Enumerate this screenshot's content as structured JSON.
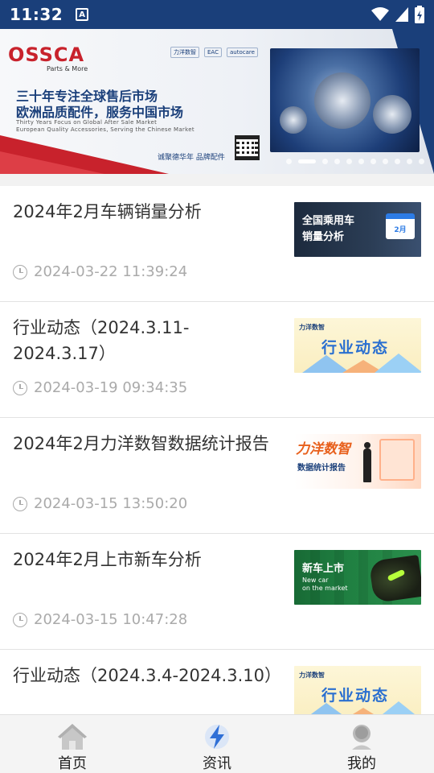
{
  "status_bar": {
    "time": "11:32",
    "a_badge": "A",
    "icons": [
      "wifi-icon",
      "signal-icon",
      "battery-icon"
    ]
  },
  "banner": {
    "brand": "OSSCA",
    "brand_sub": "Parts & More",
    "partner_logos": [
      "力洋数智",
      "EAC",
      "autocare"
    ],
    "headline1": "三十年专注全球售后市场",
    "headline2": "欧洲品质配件，服务中国市场",
    "tagline1": "Thirty Years Focus on Global After Sale Market",
    "tagline2": "European Quality Accessories, Serving the Chinese Market",
    "bottom_tag": "诚聚德华年  品牌配件",
    "carousel": {
      "count": 11,
      "active_index": 1
    }
  },
  "news": [
    {
      "title": "2024年2月车辆销量分析",
      "time": "2024-03-22 11:39:24",
      "thumb": {
        "type": "sales",
        "line1": "全国乘用车",
        "line2": "销量分析",
        "badge": "2月"
      }
    },
    {
      "title": "行业动态（2024.3.11-2024.3.17）",
      "time": "2024-03-19 09:34:35",
      "thumb": {
        "type": "trend",
        "logo": "力洋数智",
        "big": "行业动态"
      }
    },
    {
      "title": "2024年2月力洋数智数据统计报告",
      "time": "2024-03-15 13:50:20",
      "thumb": {
        "type": "stats",
        "line1": "力洋数智",
        "line2": "数据统计报告"
      }
    },
    {
      "title": "2024年2月上市新车分析",
      "time": "2024-03-15 10:47:28",
      "thumb": {
        "type": "newcar",
        "line1": "新车上市",
        "line2": "New car",
        "line3": "on the market"
      }
    },
    {
      "title": "行业动态（2024.3.4-2024.3.10）",
      "time": "",
      "thumb": {
        "type": "trend",
        "logo": "力洋数智",
        "big": "行业动态"
      }
    }
  ],
  "bottom_nav": [
    {
      "label": "首页",
      "icon": "home-icon",
      "active": false
    },
    {
      "label": "资讯",
      "icon": "lightning-icon",
      "active": true
    },
    {
      "label": "我的",
      "icon": "user-icon",
      "active": false
    }
  ],
  "colors": {
    "brand_red": "#c8222c",
    "brand_blue": "#1a3f7a",
    "accent_blue": "#2a6fd0",
    "time_gray": "#aaaaaa"
  }
}
